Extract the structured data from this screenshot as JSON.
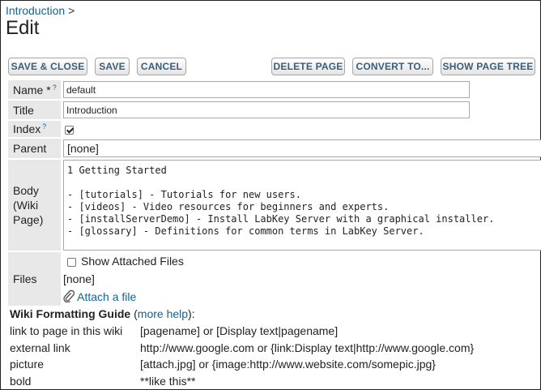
{
  "breadcrumb": {
    "link": "Introduction",
    "separator": ">"
  },
  "page_title": "Edit",
  "buttons": {
    "save_close": "SAVE & CLOSE",
    "save": "SAVE",
    "cancel": "CANCEL",
    "delete_page": "DELETE PAGE",
    "convert_to": "CONVERT TO...",
    "show_page_tree": "SHOW PAGE TREE"
  },
  "form": {
    "name": {
      "label": "Name *",
      "help": "?",
      "value": "default"
    },
    "title": {
      "label": "Title",
      "value": "Introduction"
    },
    "index": {
      "label": "Index",
      "help": "?",
      "checked": true
    },
    "parent": {
      "label": "Parent",
      "value": "[none]"
    },
    "body": {
      "label": "Body (Wiki Page)",
      "content": "1 Getting Started\n\n- [tutorials] - Tutorials for new users.\n- [videos] - Video resources for beginners and experts.\n- [installServerDemo] - Install LabKey Server with a graphical installer.\n- [glossary] - Definitions for common terms in LabKey Server."
    },
    "files": {
      "label": "Files",
      "show_attached_label": "Show Attached Files",
      "value": "[none]",
      "attach_link": "Attach a file"
    }
  },
  "guide": {
    "title": "Wiki Formatting Guide",
    "open_paren": " (",
    "more_help": "more help",
    "close_paren": "):",
    "rows": [
      {
        "k": "link to page in this wiki",
        "v": "[pagename] or [Display text|pagename]"
      },
      {
        "k": "external link",
        "v": "http://www.google.com or {link:Display text|http://www.google.com}"
      },
      {
        "k": "picture",
        "v": "[attach.jpg] or {image:http://www.website.com/somepic.jpg}"
      },
      {
        "k": "bold",
        "v": "**like this**"
      }
    ]
  },
  "colors": {
    "link": "#126495",
    "label_bg": "#e8e8e8",
    "button_text": "#3a5e78"
  }
}
